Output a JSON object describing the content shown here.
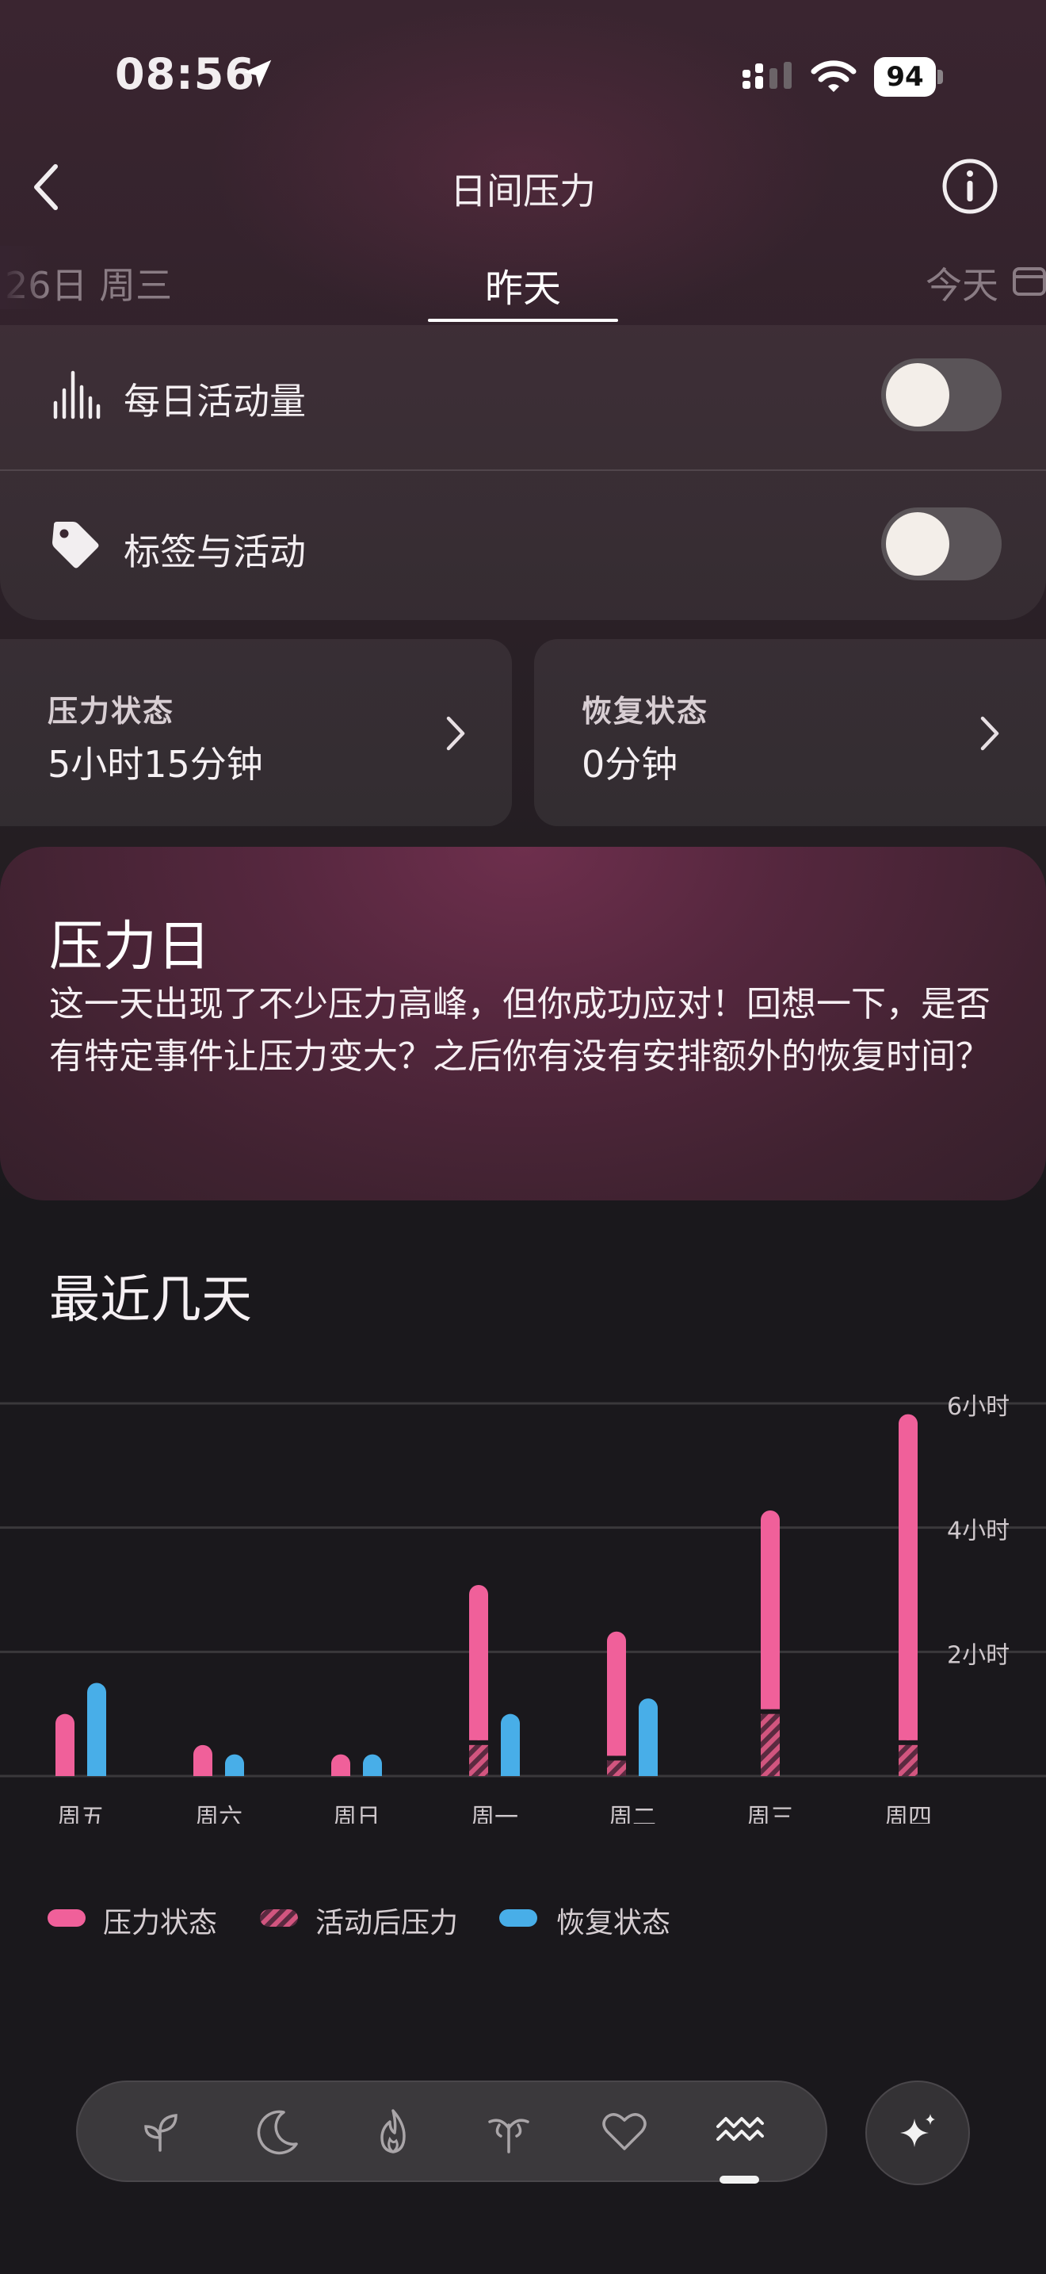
{
  "status_bar": {
    "time": "08:56",
    "battery": "94"
  },
  "header": {
    "title": "日间压力"
  },
  "date_tabs": {
    "prev": "26日 周三",
    "current": "昨天",
    "next": "今天"
  },
  "toggles": [
    {
      "label": "每日活动量",
      "on": false
    },
    {
      "label": "标签与活动",
      "on": false
    }
  ],
  "stats": {
    "stress": {
      "title": "压力状态",
      "value": "5小时15分钟"
    },
    "recovery": {
      "title": "恢复状态",
      "value": "0分钟"
    }
  },
  "insight": {
    "title": "压力日",
    "body": "这一天出现了不少压力高峰，但你成功应对！回想一下，是否有特定事件让压力变大？之后你有没有安排额外的恢复时间？"
  },
  "recent": {
    "title": "最近几天"
  },
  "chart_data": {
    "type": "bar",
    "categories": [
      "周五",
      "周六",
      "周日",
      "周一",
      "周二",
      "周三",
      "周四"
    ],
    "series": [
      {
        "name": "压力状态",
        "values": [
          1.0,
          0.5,
          0.35,
          2.5,
          2.0,
          3.2,
          5.25
        ],
        "color": "#f0609a"
      },
      {
        "name": "活动后压力",
        "values": [
          0,
          0,
          0,
          0.5,
          0.25,
          1.0,
          0.5
        ],
        "color": "#c04a7a"
      },
      {
        "name": "恢复状态",
        "values": [
          1.5,
          0.35,
          0.35,
          1.0,
          1.25,
          0,
          0
        ],
        "color": "#48aee8"
      }
    ],
    "y_ticks": [
      "2小时",
      "4小时",
      "6小时"
    ],
    "ylim": [
      0,
      6
    ],
    "stacked": [
      "压力状态",
      "活动后压力"
    ],
    "grid": true,
    "legend": "bottom"
  },
  "legend": [
    {
      "label": "压力状态",
      "color": "#f0609a"
    },
    {
      "label": "活动后压力",
      "color": "#c04a7a"
    },
    {
      "label": "恢复状态",
      "color": "#48aee8"
    }
  ],
  "nav": {
    "icons": [
      "sprout-icon",
      "moon-icon",
      "flame-icon",
      "activity-rings-icon",
      "heart-icon",
      "waves-icon"
    ],
    "active": "waves-icon"
  }
}
